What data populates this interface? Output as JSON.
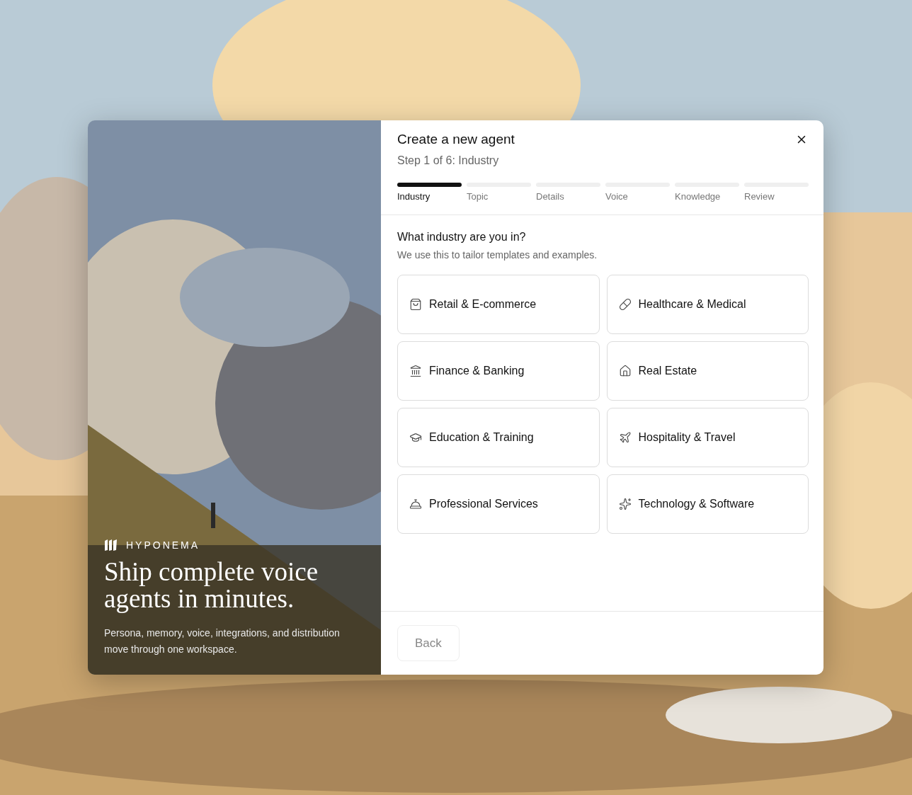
{
  "brand": {
    "name": "HYPONEMA"
  },
  "hero": {
    "title": "Ship complete voice agents in minutes.",
    "subtitle": "Persona, memory, voice, integrations, and distribution move through one workspace."
  },
  "dialog": {
    "title": "Create a new agent",
    "step_text": "Step 1 of 6: Industry"
  },
  "steps": [
    {
      "label": "Industry",
      "selected": true
    },
    {
      "label": "Topic",
      "selected": false
    },
    {
      "label": "Details",
      "selected": false
    },
    {
      "label": "Voice",
      "selected": false
    },
    {
      "label": "Knowledge",
      "selected": false
    },
    {
      "label": "Review",
      "selected": false
    }
  ],
  "question": {
    "title": "What industry are you in?",
    "hint": "We use this to tailor templates and examples."
  },
  "options": [
    {
      "label": "Retail & E-commerce",
      "kind": "bag",
      "selected": false
    },
    {
      "label": "Healthcare & Medical",
      "kind": "pill",
      "selected": false
    },
    {
      "label": "Finance & Banking",
      "kind": "bank",
      "selected": false
    },
    {
      "label": "Real Estate",
      "kind": "house",
      "selected": false
    },
    {
      "label": "Education & Training",
      "kind": "cap",
      "selected": false
    },
    {
      "label": "Hospitality & Travel",
      "kind": "plane",
      "selected": false
    },
    {
      "label": "Professional Services",
      "kind": "bell",
      "selected": false
    },
    {
      "label": "Technology & Software",
      "kind": "sparkles",
      "selected": false
    }
  ],
  "footer": {
    "back": {
      "label": "Back",
      "disabled": true
    }
  }
}
